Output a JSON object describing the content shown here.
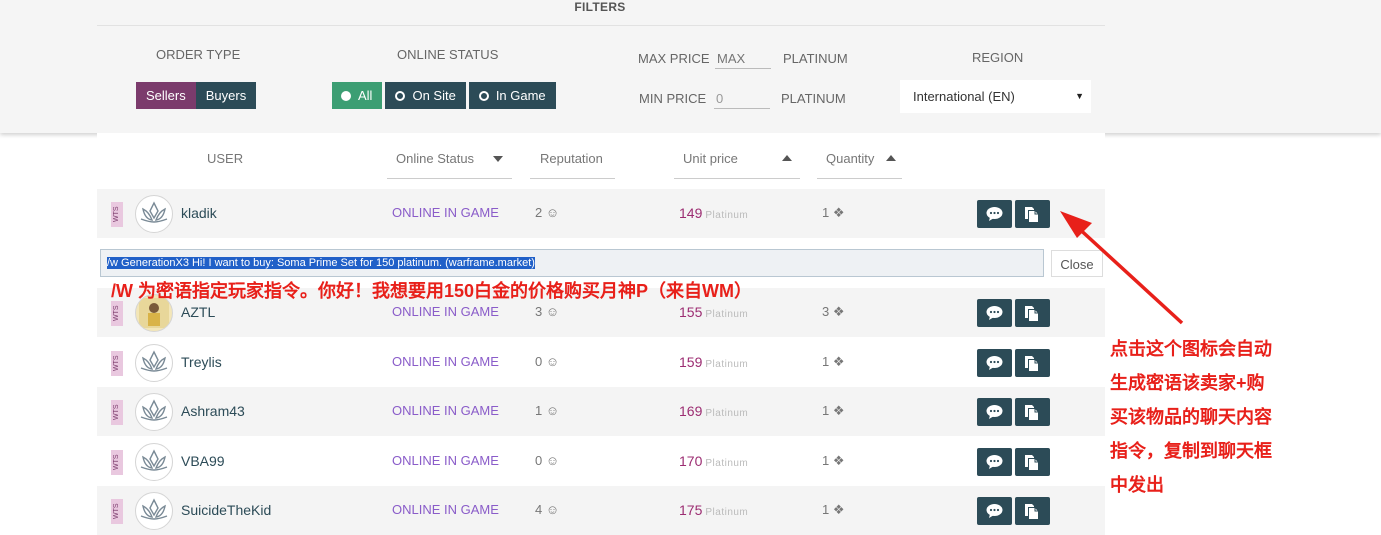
{
  "filters": {
    "title": "FILTERS",
    "order_type": {
      "label": "ORDER TYPE",
      "options": [
        "Sellers",
        "Buyers"
      ],
      "selected": "Sellers"
    },
    "online_status": {
      "label": "ONLINE STATUS",
      "options": [
        "All",
        "On Site",
        "In Game"
      ],
      "selected": "All"
    },
    "max_price": {
      "label": "MAX PRICE",
      "placeholder": "MAX",
      "unit": "PLATINUM"
    },
    "min_price": {
      "label": "MIN PRICE",
      "value": "0",
      "unit": "PLATINUM"
    },
    "region": {
      "label": "REGION",
      "selected": "International (EN)"
    }
  },
  "table": {
    "headers": {
      "user": "USER",
      "online_status": "Online Status",
      "reputation": "Reputation",
      "unit_price": "Unit price",
      "quantity": "Quantity"
    },
    "platinum_label": "Platinum",
    "wts_badge": "WTS",
    "rows": [
      {
        "user": "kladik",
        "status": "ONLINE IN GAME",
        "reputation": "2",
        "price": "149",
        "quantity": "1"
      },
      {
        "user": "AZTL",
        "status": "ONLINE IN GAME",
        "reputation": "3",
        "price": "155",
        "quantity": "3"
      },
      {
        "user": "Treylis",
        "status": "ONLINE IN GAME",
        "reputation": "0",
        "price": "159",
        "quantity": "1"
      },
      {
        "user": "Ashram43",
        "status": "ONLINE IN GAME",
        "reputation": "1",
        "price": "169",
        "quantity": "1"
      },
      {
        "user": "VBA99",
        "status": "ONLINE IN GAME",
        "reputation": "0",
        "price": "170",
        "quantity": "1"
      },
      {
        "user": "SuicideTheKid",
        "status": "ONLINE IN GAME",
        "reputation": "4",
        "price": "175",
        "quantity": "1"
      }
    ]
  },
  "whisper": {
    "message": "/w GenerationX3 Hi! I want to buy: Soma Prime Set for 150 platinum. (warframe.market)",
    "close_label": "Close"
  },
  "annotations": {
    "top": "/W 为密语指定玩家指令。你好！我想要用150白金的价格购买月神P（来自WM）",
    "right_lines": [
      "点击这个图标会自动",
      "生成密语该卖家+购",
      "买该物品的聊天内容",
      "指令，复制到聊天框",
      "中发出"
    ]
  },
  "colors": {
    "accent_purple": "#7b3b6c",
    "accent_green": "#3c9e73",
    "button_dark": "#2c4b57",
    "status_purple": "#8a5cc9",
    "price_magenta": "#9c2d72",
    "annotation_red": "#e8201a"
  }
}
